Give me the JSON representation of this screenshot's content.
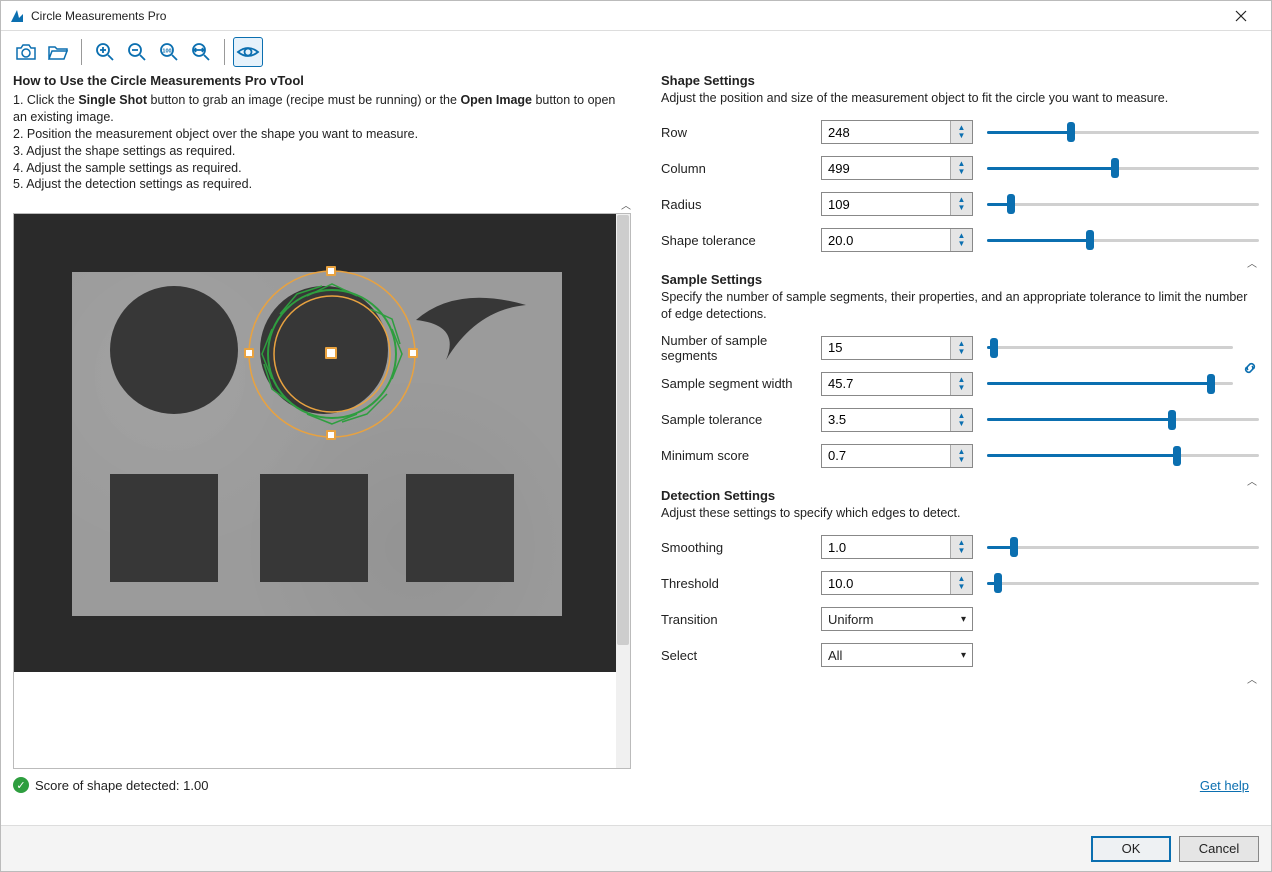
{
  "window": {
    "title": "Circle Measurements Pro"
  },
  "howto": {
    "title": "How to Use the Circle Measurements Pro vTool",
    "line1_prefix": "1. Click the ",
    "line1_bold1": "Single Shot",
    "line1_mid": " button to grab an image (recipe must be running) or the ",
    "line1_bold2": "Open Image",
    "line1_suffix": " button to open an existing image.",
    "line2": "2. Position the measurement object over the shape you want to measure.",
    "line3": "3. Adjust the shape settings as required.",
    "line4": "4. Adjust the sample settings as required.",
    "line5": "5. Adjust the detection settings as required."
  },
  "status": {
    "label": "Score of shape detected: ",
    "value": "1.00"
  },
  "shape": {
    "title": "Shape Settings",
    "desc": "Adjust the position and size of the measurement object to fit the circle you want to measure.",
    "row": {
      "label": "Row",
      "value": "248",
      "pct": 31
    },
    "column": {
      "label": "Column",
      "value": "499",
      "pct": 47
    },
    "radius": {
      "label": "Radius",
      "value": "109",
      "pct": 9
    },
    "tolerance": {
      "label": "Shape tolerance",
      "value": "20.0",
      "pct": 38
    }
  },
  "sample": {
    "title": "Sample Settings",
    "desc": "Specify the number of sample segments, their properties, and an appropriate tolerance to limit the number of edge detections.",
    "segments": {
      "label": "Number of sample segments",
      "value": "15",
      "pct": 3
    },
    "segwidth": {
      "label": "Sample segment width",
      "value": "45.7",
      "pct": 91
    },
    "tolerance": {
      "label": "Sample tolerance",
      "value": "3.5",
      "pct": 68
    },
    "minscore": {
      "label": "Minimum score",
      "value": "0.7",
      "pct": 70
    }
  },
  "detection": {
    "title": "Detection Settings",
    "desc": "Adjust these settings to specify which edges to detect.",
    "smoothing": {
      "label": "Smoothing",
      "value": "1.0",
      "pct": 10
    },
    "threshold": {
      "label": "Threshold",
      "value": "10.0",
      "pct": 4
    },
    "transition": {
      "label": "Transition",
      "value": "Uniform"
    },
    "select": {
      "label": "Select",
      "value": "All"
    }
  },
  "footer": {
    "ok": "OK",
    "cancel": "Cancel",
    "help": "Get help"
  }
}
